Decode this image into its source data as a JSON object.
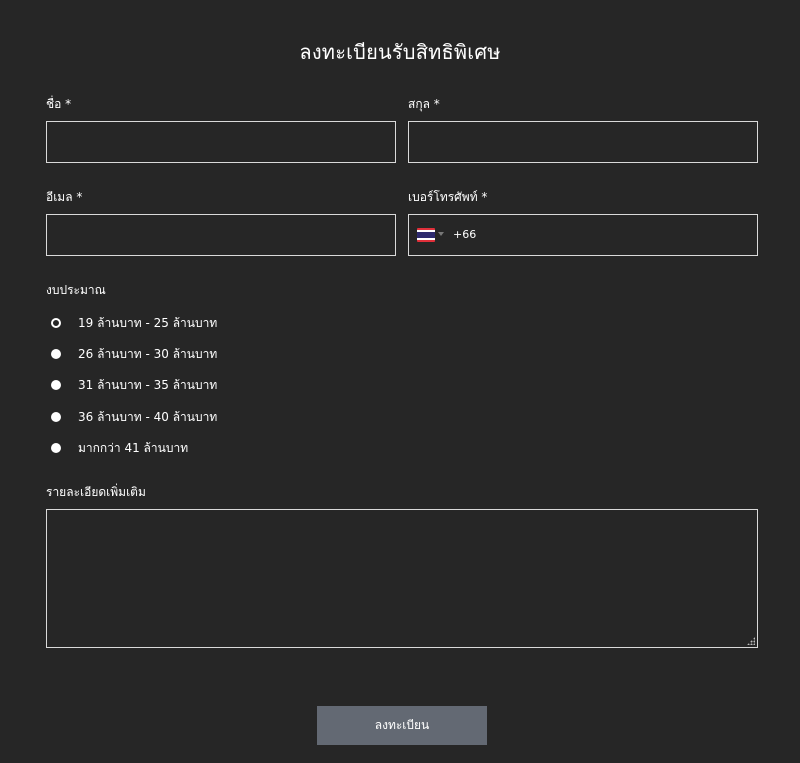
{
  "form": {
    "title": "ลงทะเบียนรับสิทธิพิเศษ",
    "first_name": {
      "label": "ชื่อ *",
      "value": ""
    },
    "last_name": {
      "label": "สกุล *",
      "value": ""
    },
    "email": {
      "label": "อีเมล *",
      "value": ""
    },
    "phone": {
      "label": "เบอร์โทรศัพท์ *",
      "country": "Thailand",
      "dial_code": "+66",
      "value": ""
    },
    "budget": {
      "label": "งบประมาณ",
      "options": [
        {
          "label": "19 ล้านบาท - 25 ล้านบาท",
          "selected": true
        },
        {
          "label": "26 ล้านบาท - 30 ล้านบาท",
          "selected": false
        },
        {
          "label": "31 ล้านบาท - 35 ล้านบาท",
          "selected": false
        },
        {
          "label": "36 ล้านบาท - 40 ล้านบาท",
          "selected": false
        },
        {
          "label": "มากกว่า 41 ล้านบาท",
          "selected": false
        }
      ]
    },
    "details": {
      "label": "รายละเอียดเพิ่มเติม",
      "value": ""
    },
    "submit_label": "ลงทะเบียน"
  },
  "colors": {
    "background": "#262626",
    "text": "#ffffff",
    "border": "#d9d9d9",
    "button": "#636973"
  }
}
